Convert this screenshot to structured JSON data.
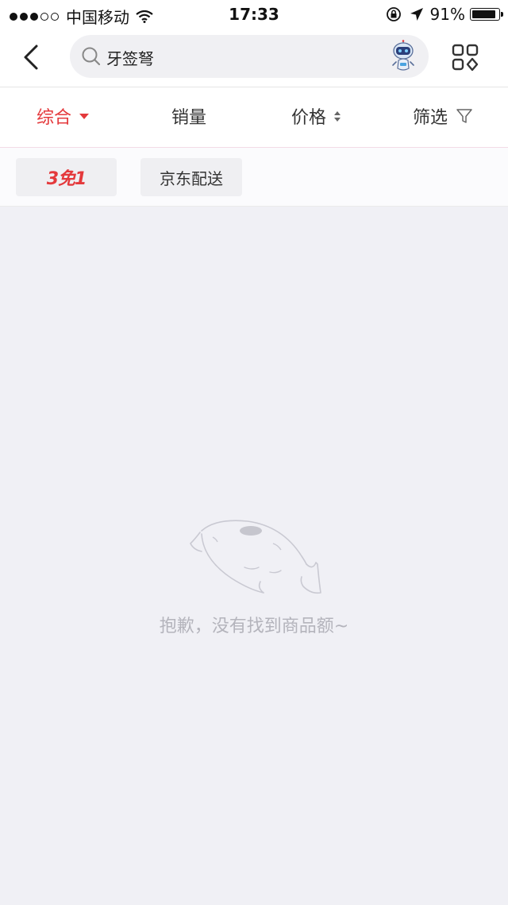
{
  "status_bar": {
    "carrier": "中国移动",
    "time": "17:33",
    "battery_percent": "91%",
    "battery_level": 0.91,
    "signal_bars_filled": 3,
    "signal_bars_total": 5
  },
  "header": {
    "search_query": "牙签弩",
    "icons": {
      "back": "chevron-left-icon",
      "search": "search-icon",
      "assistant": "robot-icon",
      "menu": "grid-menu-icon"
    }
  },
  "sort_bar": {
    "comprehensive_label": "综合",
    "sales_label": "销量",
    "price_label": "价格",
    "filter_label": "筛选",
    "active_color": "#e4393c"
  },
  "tags": {
    "promo_label": "3免1",
    "jd_delivery_label": "京东配送"
  },
  "empty_state": {
    "message": "抱歉，没有找到商品额~"
  }
}
